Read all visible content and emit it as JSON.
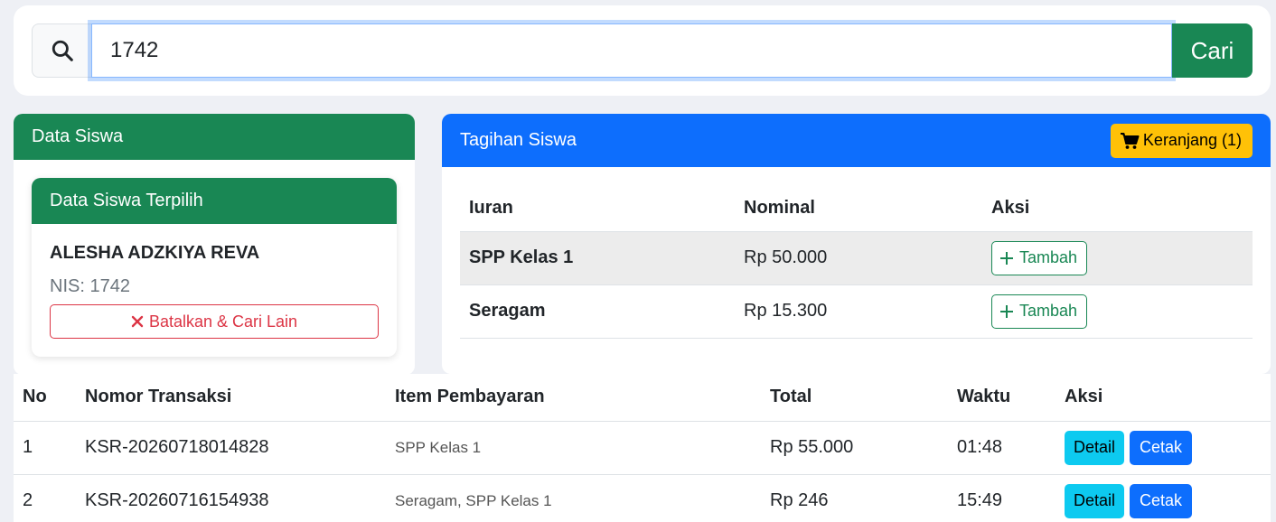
{
  "search": {
    "icon": "search-icon",
    "value": "1742",
    "button_label": "Cari",
    "button_color": "#198754"
  },
  "student_card": {
    "title": "Data Siswa",
    "selected_title": "Data Siswa Terpilih",
    "name": "ALESHA ADZKIYA REVA",
    "nis": "NIS: 1742",
    "cancel_label": "Batalkan & Cari Lain",
    "cancel_icon": "close-icon"
  },
  "bills_card": {
    "title": "Tagihan Siswa",
    "cart_label": "Keranjang (1)",
    "cart_icon": "cart-icon",
    "columns": [
      "Iuran",
      "Nominal",
      "Aksi"
    ],
    "rows": [
      {
        "name": "SPP Kelas 1",
        "amount": "Rp 50.000",
        "action": "Tambah"
      },
      {
        "name": "Seragam",
        "amount": "Rp 15.300",
        "action": "Tambah"
      }
    ]
  },
  "transactions": {
    "columns": [
      "No",
      "Nomor Transaksi",
      "Item Pembayaran",
      "Total",
      "Waktu",
      "Aksi"
    ],
    "rows": [
      {
        "no": "1",
        "number": "KSR-20260718014828",
        "items": "SPP Kelas 1",
        "total": "Rp 55.000",
        "time": "01:48",
        "detail": "Detail",
        "print": "Cetak"
      },
      {
        "no": "2",
        "number": "KSR-20260716154938",
        "items": "Seragam, SPP Kelas 1",
        "total": "Rp 246",
        "time": "15:49",
        "detail": "Detail",
        "print": "Cetak"
      }
    ]
  },
  "colors": {
    "green": "#198754",
    "blue": "#0d6efd",
    "yellow": "#ffc107",
    "cyan": "#0dcaf0",
    "red": "#dc3545"
  }
}
